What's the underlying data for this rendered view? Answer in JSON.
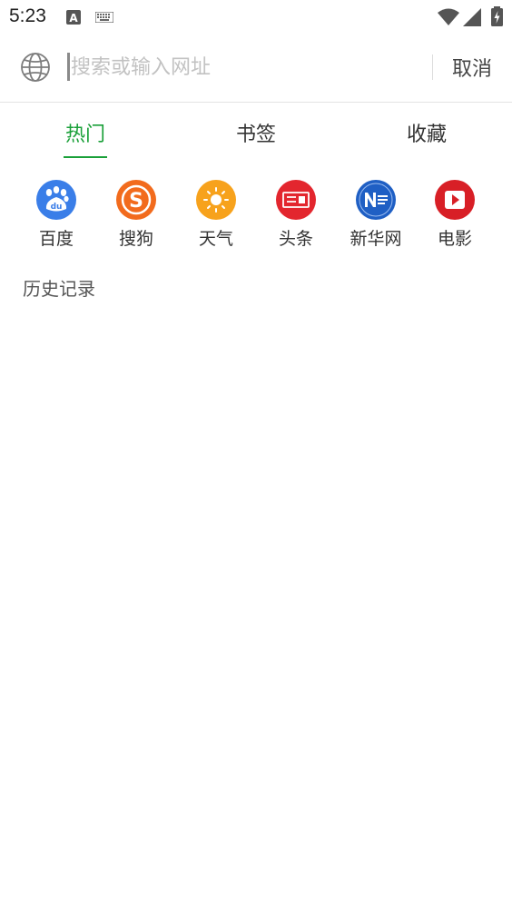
{
  "status_bar": {
    "time": "5:23",
    "icons": [
      "a-notification-icon",
      "keyboard-icon",
      "wifi-icon",
      "cell-signal-icon",
      "battery-charging-icon"
    ]
  },
  "search": {
    "placeholder": "搜索或输入网址",
    "value": "",
    "cancel_label": "取消",
    "leading_icon": "globe-icon"
  },
  "tabs": [
    {
      "label": "热门",
      "active": true
    },
    {
      "label": "书签",
      "active": false
    },
    {
      "label": "收藏",
      "active": false
    }
  ],
  "colors": {
    "accent": "#1aa039"
  },
  "shortcuts": [
    {
      "label": "百度",
      "icon": "baidu-icon",
      "color": "#3a7ee8"
    },
    {
      "label": "搜狗",
      "icon": "sogou-icon",
      "color": "#f26b1d"
    },
    {
      "label": "天气",
      "icon": "weather-sun-icon",
      "color": "#f7a21c"
    },
    {
      "label": "头条",
      "icon": "toutiao-news-icon",
      "color": "#e3262e"
    },
    {
      "label": "新华网",
      "icon": "xinhua-news-icon",
      "color": "#1f5fc4"
    },
    {
      "label": "电影",
      "icon": "movie-play-icon",
      "color": "#d81f26"
    }
  ],
  "history": {
    "title": "历史记录"
  }
}
